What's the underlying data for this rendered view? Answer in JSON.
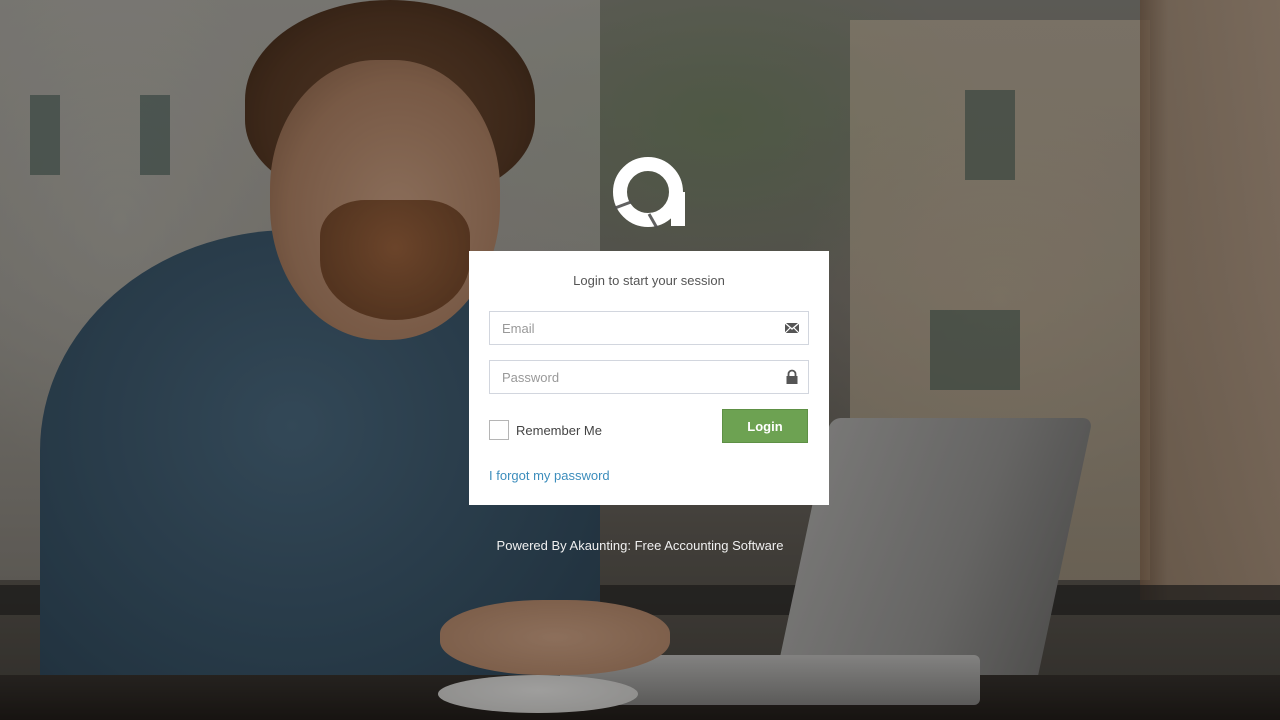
{
  "login": {
    "message": "Login to start your session",
    "email_placeholder": "Email",
    "password_placeholder": "Password",
    "remember_label": "Remember Me",
    "login_button": "Login",
    "forgot_link": "I forgot my password"
  },
  "footer": {
    "powered_by": "Powered By Akaunting: Free Accounting Software"
  },
  "icons": {
    "logo": "akaunting-logo-icon",
    "email": "envelope-icon",
    "password": "lock-icon"
  },
  "colors": {
    "login_button": "#6da252",
    "link": "#3c8dbc",
    "box_background": "#ffffff"
  }
}
